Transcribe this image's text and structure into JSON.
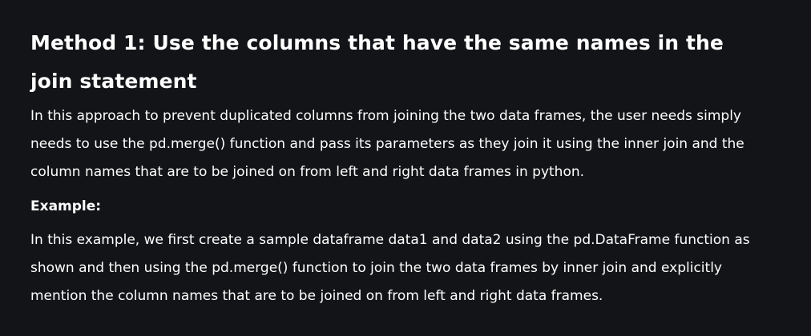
{
  "article": {
    "heading": "Method 1: Use the columns that have the same names in the join statement",
    "intro_paragraph": "In this approach to prevent duplicated columns from joining the two data frames, the user needs simply needs to use the pd.merge() function and pass its parameters as they join it using the inner join and the column names that are to be joined on from left and right data frames in python.",
    "example_label": "Example:",
    "example_paragraph": "In this example, we first create a sample dataframe data1 and data2 using the pd.DataFrame function as shown and then using the pd.merge() function to join the two data frames by inner join and explicitly mention the column names that are to be joined on from left and right data frames."
  },
  "colors": {
    "background": "#131417",
    "text": "#ffffff"
  }
}
